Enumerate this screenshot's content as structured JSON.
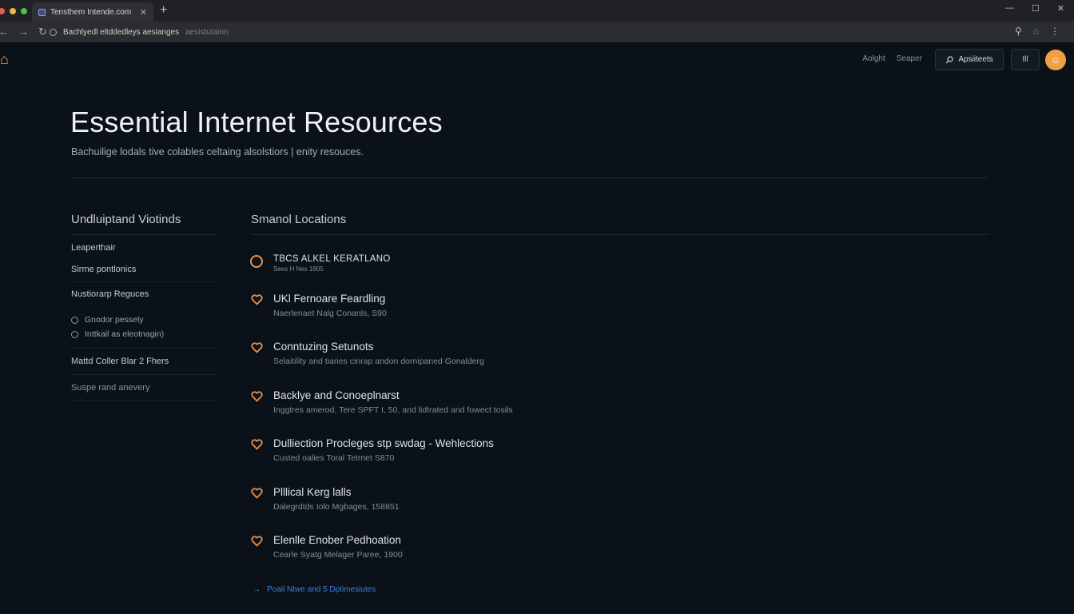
{
  "browser": {
    "tab_title": "Tensthem Intende.com",
    "url_main": "Bachlyedl eltddedleys aesianges",
    "url_dim": "aesistutaion"
  },
  "site": {
    "nav": [
      "Aolght",
      "Seaper"
    ],
    "apply_label": "Apsiiteets",
    "menu_label": "Ill"
  },
  "hero": {
    "title": "Essential Internet Resources",
    "subtitle": "Bachuilige lodals tive colables celtaing alsolstiors | enity resouces."
  },
  "sidebar": {
    "heading": "Undluiptand Viotinds",
    "items": [
      "Leaperthair",
      "Sirme pontlonics",
      "Nustiorarp Reguces"
    ],
    "sub_items": [
      "Gnodor pessely",
      "Inttkail as eleotnagin)"
    ],
    "items_after": [
      "Mattd Coller Blar 2 Fhers",
      "Suspe rand anevery"
    ]
  },
  "main": {
    "heading": "Smanol Locations",
    "locations": [
      {
        "title": "TBCS ALKEL KERATLANO",
        "subtitle": "Sees H Nes 1805"
      },
      {
        "title": "UKl Fernoare Feardling",
        "subtitle": "Naerlenaet Nalg Conanls, S90"
      },
      {
        "title": "Conntuzing Setunots",
        "subtitle": "Selaitility and tiaries cinrap andon dornipaned Gonalderg"
      },
      {
        "title": "Backlye and Conoeplnarst",
        "subtitle": "Inggtres amerod, Tere SPFT I, 50, and lidtrated and fowect tosils"
      },
      {
        "title": "Dulliection Procleges stp swdag - Wehlections",
        "subtitle": "Custed oalies Toral Tetrnet S870"
      },
      {
        "title": "Plllical Kerg lalls",
        "subtitle": "Dalegrdtds Iolo Mgbages, 158851"
      },
      {
        "title": "Elenlle Enober Pedhoation",
        "subtitle": "Cearle Syatg Melager Paree, 1900"
      }
    ],
    "more_link": "Poail Ntwe and 5 Dptimesiutes"
  }
}
